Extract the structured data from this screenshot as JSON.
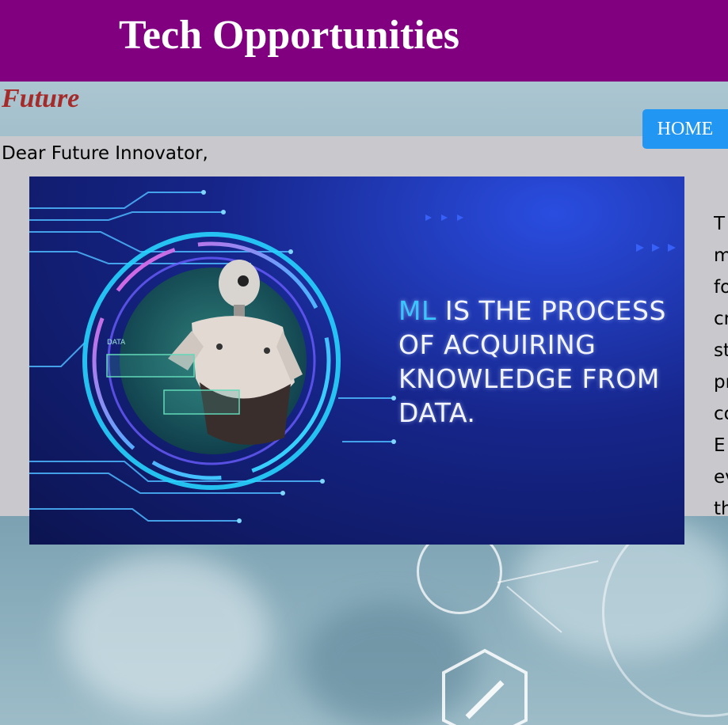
{
  "header": {
    "title": "Tech Opportunities"
  },
  "subtitle": "Future",
  "nav": {
    "home_label": "HOME"
  },
  "content": {
    "greeting": "Dear Future Innovator,",
    "body_lines": [
      "T",
      "m",
      "fo",
      "cr",
      "st",
      "pr",
      "co",
      "E",
      "ev",
      "th"
    ]
  },
  "banner": {
    "accent_text": "ML",
    "line1_rest": " IS THE PROCESS",
    "line2": "OF ACQUIRING",
    "line3": "KNOWLEDGE FROM",
    "line4": "DATA.",
    "screen_label": "DATA"
  },
  "colors": {
    "header_bg": "#800080",
    "subtitle": "#a52a2a",
    "home_button": "#2196f3",
    "content_bg": "#c9c8cc",
    "banner_accent": "#39c6ff"
  }
}
